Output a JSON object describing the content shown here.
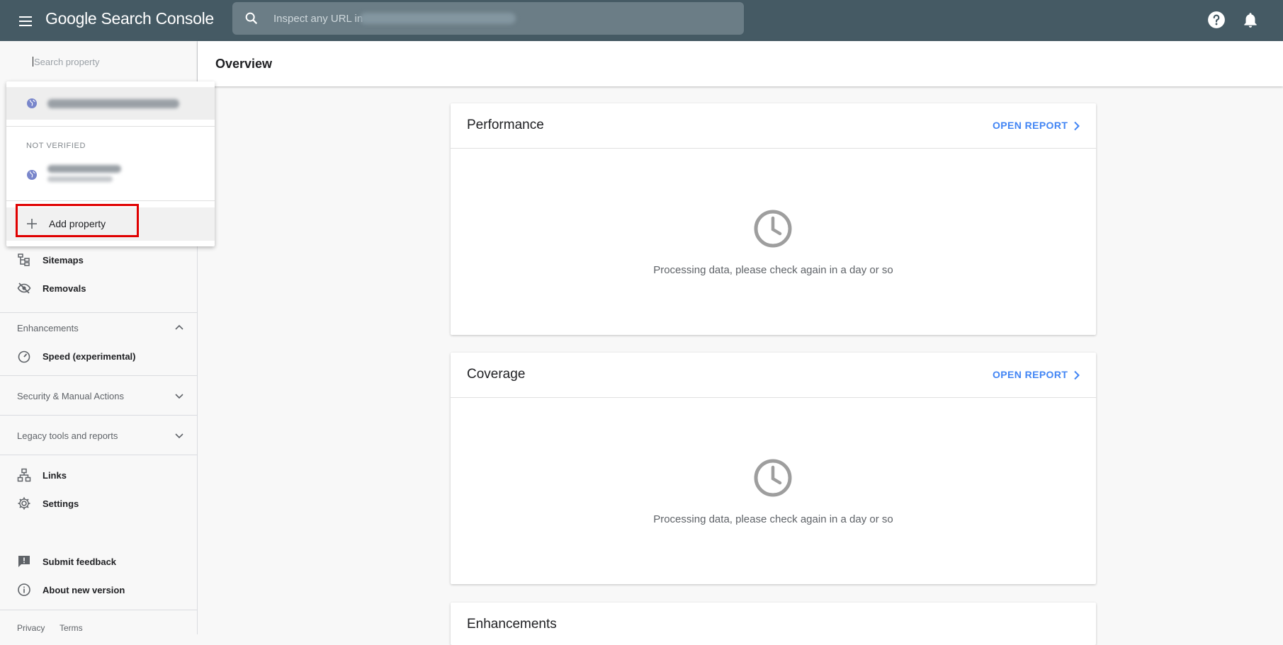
{
  "topbar": {
    "brand": "Google Search Console",
    "search_placeholder": "Inspect any URL in",
    "search_property_blurred": true
  },
  "sidebar": {
    "property_search_placeholder": "Search property",
    "items_top": [
      {
        "label": "Sitemaps",
        "icon": "sitemap-icon"
      },
      {
        "label": "Removals",
        "icon": "eye-off-icon"
      }
    ],
    "enhancements": {
      "label": "Enhancements",
      "expanded": true,
      "items": [
        {
          "label": "Speed (experimental)",
          "icon": "speedometer-icon"
        }
      ]
    },
    "security": {
      "label": "Security & Manual Actions"
    },
    "legacy": {
      "label": "Legacy tools and reports"
    },
    "items_bottom": [
      {
        "label": "Links",
        "icon": "links-icon"
      },
      {
        "label": "Settings",
        "icon": "gear-icon"
      }
    ],
    "feedback": [
      {
        "label": "Submit feedback",
        "icon": "feedback-icon"
      },
      {
        "label": "About new version",
        "icon": "info-icon"
      }
    ],
    "footer": {
      "privacy": "Privacy",
      "terms": "Terms"
    }
  },
  "dropdown": {
    "not_verified_label": "NOT VERIFIED",
    "add_property_label": "Add property"
  },
  "main": {
    "page_title": "Overview",
    "cards": [
      {
        "title": "Performance",
        "action": "OPEN REPORT",
        "message": "Processing data, please check again in a day or so"
      },
      {
        "title": "Coverage",
        "action": "OPEN REPORT",
        "message": "Processing data, please check again in a day or so"
      },
      {
        "title": "Enhancements"
      }
    ]
  },
  "colors": {
    "topbar": "#455a64",
    "accent": "#4285f4",
    "highlight": "#e00000"
  }
}
